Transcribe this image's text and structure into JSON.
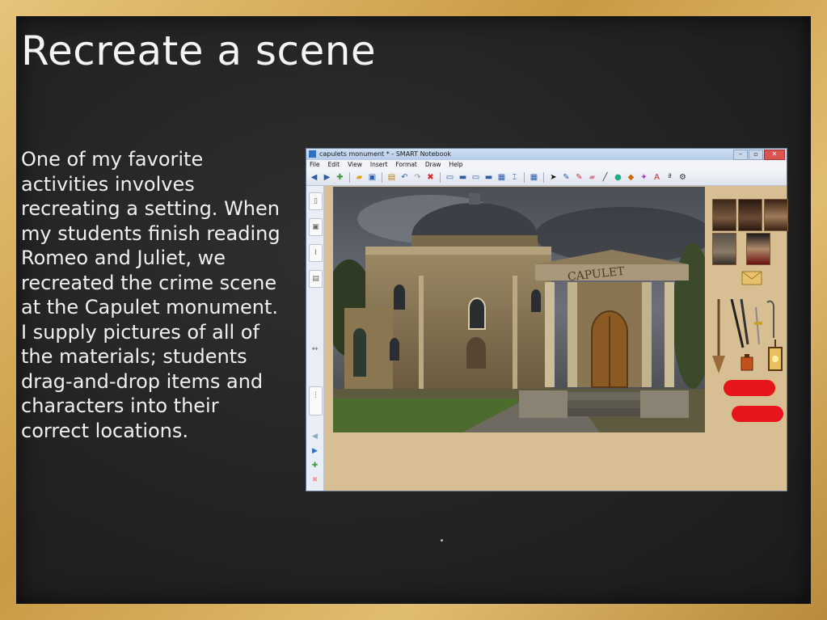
{
  "slide": {
    "title": "Recreate a scene",
    "body": "One of my favorite activities involves recreating a setting. When my students finish reading Romeo and Juliet, we recreated the crime scene at the Capulet monument. I supply pictures of all of the materials; students drag-and-drop items and characters into their correct locations."
  },
  "window": {
    "title": "capulets monument * - SMART Notebook",
    "controls": {
      "minimize": "–",
      "maximize": "▫",
      "close": "✕"
    },
    "menu": [
      "File",
      "Edit",
      "View",
      "Insert",
      "Format",
      "Draw",
      "Help"
    ],
    "toolbar_icons": [
      "back-arrow-icon",
      "forward-arrow-icon",
      "add-page-icon",
      "open-folder-icon",
      "save-icon",
      "paste-icon",
      "undo-icon",
      "redo-icon",
      "delete-icon",
      "screen-shade-icon",
      "display-icon",
      "capture-icon",
      "dual-display-icon",
      "document-camera-icon",
      "capture-tool-icon",
      "table-icon",
      "select-icon",
      "pen-icon",
      "creative-pen-icon",
      "eraser-icon",
      "line-icon",
      "shape-icon",
      "fill-icon",
      "magic-pen-icon",
      "text-icon",
      "font-icon",
      "more-tools-icon"
    ]
  },
  "canvas": {
    "photo_text": "CAPULET"
  },
  "colors": {
    "accent_red": "#e8141b",
    "chalkboard": "#232323",
    "frame": "#c99a45",
    "canvas_bg": "#d8bf93"
  }
}
